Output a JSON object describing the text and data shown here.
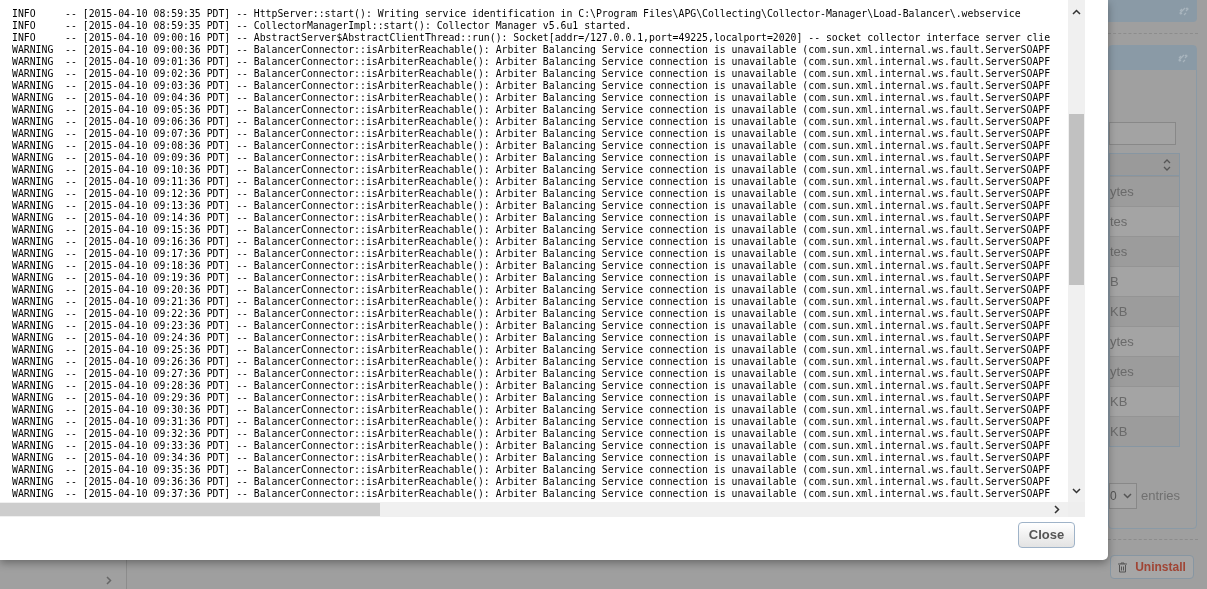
{
  "log_dialog": {
    "lines": [
      "INFO     -- [2015-04-10 08:59:35 PDT] -- HttpServer::start(): Writing service identification in C:\\Program Files\\APG\\Collecting\\Collector-Manager\\Load-Balancer\\.webservice",
      "INFO     -- [2015-04-10 08:59:35 PDT] -- CollectorManagerImpl::start(): Collector Manager v5.6u1 started.",
      "INFO     -- [2015-04-10 09:00:16 PDT] -- AbstractServer$AbstractClientThread::run(): Socket[addr=/127.0.0.1,port=49225,localport=2020] -- socket collector interface server clie",
      "WARNING  -- [2015-04-10 09:00:36 PDT] -- BalancerConnector::isArbiterReachable(): Arbiter Balancing Service connection is unavailable (com.sun.xml.internal.ws.fault.ServerSOAPF",
      "WARNING  -- [2015-04-10 09:01:36 PDT] -- BalancerConnector::isArbiterReachable(): Arbiter Balancing Service connection is unavailable (com.sun.xml.internal.ws.fault.ServerSOAPF",
      "WARNING  -- [2015-04-10 09:02:36 PDT] -- BalancerConnector::isArbiterReachable(): Arbiter Balancing Service connection is unavailable (com.sun.xml.internal.ws.fault.ServerSOAPF",
      "WARNING  -- [2015-04-10 09:03:36 PDT] -- BalancerConnector::isArbiterReachable(): Arbiter Balancing Service connection is unavailable (com.sun.xml.internal.ws.fault.ServerSOAPF",
      "WARNING  -- [2015-04-10 09:04:36 PDT] -- BalancerConnector::isArbiterReachable(): Arbiter Balancing Service connection is unavailable (com.sun.xml.internal.ws.fault.ServerSOAPF",
      "WARNING  -- [2015-04-10 09:05:36 PDT] -- BalancerConnector::isArbiterReachable(): Arbiter Balancing Service connection is unavailable (com.sun.xml.internal.ws.fault.ServerSOAPF",
      "WARNING  -- [2015-04-10 09:06:36 PDT] -- BalancerConnector::isArbiterReachable(): Arbiter Balancing Service connection is unavailable (com.sun.xml.internal.ws.fault.ServerSOAPF",
      "WARNING  -- [2015-04-10 09:07:36 PDT] -- BalancerConnector::isArbiterReachable(): Arbiter Balancing Service connection is unavailable (com.sun.xml.internal.ws.fault.ServerSOAPF",
      "WARNING  -- [2015-04-10 09:08:36 PDT] -- BalancerConnector::isArbiterReachable(): Arbiter Balancing Service connection is unavailable (com.sun.xml.internal.ws.fault.ServerSOAPF",
      "WARNING  -- [2015-04-10 09:09:36 PDT] -- BalancerConnector::isArbiterReachable(): Arbiter Balancing Service connection is unavailable (com.sun.xml.internal.ws.fault.ServerSOAPF",
      "WARNING  -- [2015-04-10 09:10:36 PDT] -- BalancerConnector::isArbiterReachable(): Arbiter Balancing Service connection is unavailable (com.sun.xml.internal.ws.fault.ServerSOAPF",
      "WARNING  -- [2015-04-10 09:11:36 PDT] -- BalancerConnector::isArbiterReachable(): Arbiter Balancing Service connection is unavailable (com.sun.xml.internal.ws.fault.ServerSOAPF",
      "WARNING  -- [2015-04-10 09:12:36 PDT] -- BalancerConnector::isArbiterReachable(): Arbiter Balancing Service connection is unavailable (com.sun.xml.internal.ws.fault.ServerSOAPF",
      "WARNING  -- [2015-04-10 09:13:36 PDT] -- BalancerConnector::isArbiterReachable(): Arbiter Balancing Service connection is unavailable (com.sun.xml.internal.ws.fault.ServerSOAPF",
      "WARNING  -- [2015-04-10 09:14:36 PDT] -- BalancerConnector::isArbiterReachable(): Arbiter Balancing Service connection is unavailable (com.sun.xml.internal.ws.fault.ServerSOAPF",
      "WARNING  -- [2015-04-10 09:15:36 PDT] -- BalancerConnector::isArbiterReachable(): Arbiter Balancing Service connection is unavailable (com.sun.xml.internal.ws.fault.ServerSOAPF",
      "WARNING  -- [2015-04-10 09:16:36 PDT] -- BalancerConnector::isArbiterReachable(): Arbiter Balancing Service connection is unavailable (com.sun.xml.internal.ws.fault.ServerSOAPF",
      "WARNING  -- [2015-04-10 09:17:36 PDT] -- BalancerConnector::isArbiterReachable(): Arbiter Balancing Service connection is unavailable (com.sun.xml.internal.ws.fault.ServerSOAPF",
      "WARNING  -- [2015-04-10 09:18:36 PDT] -- BalancerConnector::isArbiterReachable(): Arbiter Balancing Service connection is unavailable (com.sun.xml.internal.ws.fault.ServerSOAPF",
      "WARNING  -- [2015-04-10 09:19:36 PDT] -- BalancerConnector::isArbiterReachable(): Arbiter Balancing Service connection is unavailable (com.sun.xml.internal.ws.fault.ServerSOAPF",
      "WARNING  -- [2015-04-10 09:20:36 PDT] -- BalancerConnector::isArbiterReachable(): Arbiter Balancing Service connection is unavailable (com.sun.xml.internal.ws.fault.ServerSOAPF",
      "WARNING  -- [2015-04-10 09:21:36 PDT] -- BalancerConnector::isArbiterReachable(): Arbiter Balancing Service connection is unavailable (com.sun.xml.internal.ws.fault.ServerSOAPF",
      "WARNING  -- [2015-04-10 09:22:36 PDT] -- BalancerConnector::isArbiterReachable(): Arbiter Balancing Service connection is unavailable (com.sun.xml.internal.ws.fault.ServerSOAPF",
      "WARNING  -- [2015-04-10 09:23:36 PDT] -- BalancerConnector::isArbiterReachable(): Arbiter Balancing Service connection is unavailable (com.sun.xml.internal.ws.fault.ServerSOAPF",
      "WARNING  -- [2015-04-10 09:24:36 PDT] -- BalancerConnector::isArbiterReachable(): Arbiter Balancing Service connection is unavailable (com.sun.xml.internal.ws.fault.ServerSOAPF",
      "WARNING  -- [2015-04-10 09:25:36 PDT] -- BalancerConnector::isArbiterReachable(): Arbiter Balancing Service connection is unavailable (com.sun.xml.internal.ws.fault.ServerSOAPF",
      "WARNING  -- [2015-04-10 09:26:36 PDT] -- BalancerConnector::isArbiterReachable(): Arbiter Balancing Service connection is unavailable (com.sun.xml.internal.ws.fault.ServerSOAPF",
      "WARNING  -- [2015-04-10 09:27:36 PDT] -- BalancerConnector::isArbiterReachable(): Arbiter Balancing Service connection is unavailable (com.sun.xml.internal.ws.fault.ServerSOAPF",
      "WARNING  -- [2015-04-10 09:28:36 PDT] -- BalancerConnector::isArbiterReachable(): Arbiter Balancing Service connection is unavailable (com.sun.xml.internal.ws.fault.ServerSOAPF",
      "WARNING  -- [2015-04-10 09:29:36 PDT] -- BalancerConnector::isArbiterReachable(): Arbiter Balancing Service connection is unavailable (com.sun.xml.internal.ws.fault.ServerSOAPF",
      "WARNING  -- [2015-04-10 09:30:36 PDT] -- BalancerConnector::isArbiterReachable(): Arbiter Balancing Service connection is unavailable (com.sun.xml.internal.ws.fault.ServerSOAPF",
      "WARNING  -- [2015-04-10 09:31:36 PDT] -- BalancerConnector::isArbiterReachable(): Arbiter Balancing Service connection is unavailable (com.sun.xml.internal.ws.fault.ServerSOAPF",
      "WARNING  -- [2015-04-10 09:32:36 PDT] -- BalancerConnector::isArbiterReachable(): Arbiter Balancing Service connection is unavailable (com.sun.xml.internal.ws.fault.ServerSOAPF",
      "WARNING  -- [2015-04-10 09:33:36 PDT] -- BalancerConnector::isArbiterReachable(): Arbiter Balancing Service connection is unavailable (com.sun.xml.internal.ws.fault.ServerSOAPF",
      "WARNING  -- [2015-04-10 09:34:36 PDT] -- BalancerConnector::isArbiterReachable(): Arbiter Balancing Service connection is unavailable (com.sun.xml.internal.ws.fault.ServerSOAPF",
      "WARNING  -- [2015-04-10 09:35:36 PDT] -- BalancerConnector::isArbiterReachable(): Arbiter Balancing Service connection is unavailable (com.sun.xml.internal.ws.fault.ServerSOAPF",
      "WARNING  -- [2015-04-10 09:36:36 PDT] -- BalancerConnector::isArbiterReachable(): Arbiter Balancing Service connection is unavailable (com.sun.xml.internal.ws.fault.ServerSOAPF",
      "WARNING  -- [2015-04-10 09:37:36 PDT] -- BalancerConnector::isArbiterReachable(): Arbiter Balancing Service connection is unavailable (com.sun.xml.internal.ws.fault.ServerSOAPF"
    ],
    "close_button": "Close"
  },
  "background": {
    "table_cells": [
      "ytes",
      "tes",
      "tes",
      "B",
      "KB",
      "ytes",
      "ytes",
      "KB",
      "KB"
    ],
    "page_size_value": "0",
    "entries_label": "entries",
    "uninstall_button": "Uninstall"
  }
}
